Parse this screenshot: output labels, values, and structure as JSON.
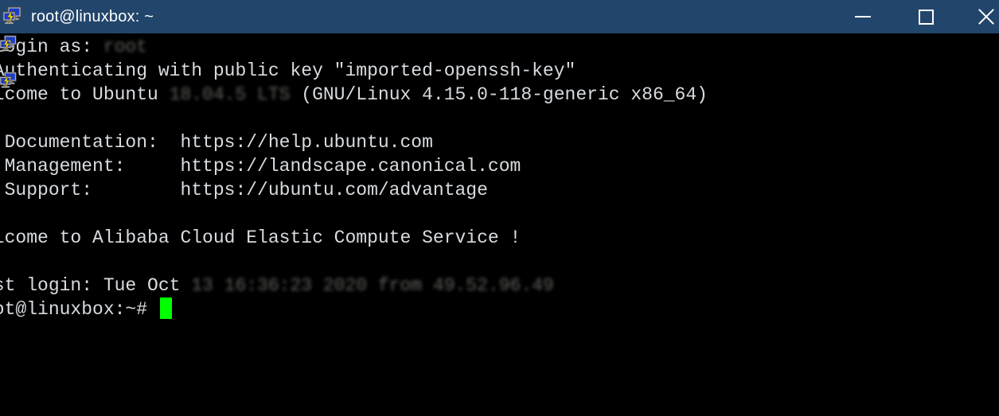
{
  "window": {
    "title": "root@linuxbox: ~",
    "app_icon": "putty-computer-icon",
    "titlebar_color": "#22456b",
    "background_color": "#000000",
    "controls": {
      "minimize_label": "—",
      "maximize_label": "☐",
      "close_label": "✕"
    }
  },
  "terminal": {
    "foreground_color": "#d8dce0",
    "cursor_color": "#00ff00",
    "lines": [
      {
        "id": "line-login-as",
        "segments": [
          {
            "text": " login as: ",
            "blurred": false
          },
          {
            "text": "root",
            "blurred": true
          }
        ]
      },
      {
        "id": "line-authenticating",
        "segments": [
          {
            "text": " Authenticating with public key \"imported-openssh-key\"",
            "blurred": false
          }
        ]
      },
      {
        "id": "line-welcome-ubuntu",
        "segments": [
          {
            "text": "elcome to Ubuntu ",
            "blurred": false
          },
          {
            "text": "18.04.5 LTS",
            "blurred": true
          },
          {
            "text": " (GNU/Linux 4.15.0-118-generic x86_64)",
            "blurred": false
          }
        ]
      },
      {
        "id": "line-blank-1",
        "segments": [
          {
            "text": " ",
            "blurred": false
          }
        ]
      },
      {
        "id": "line-documentation",
        "segments": [
          {
            "text": "* Documentation:  https://help.ubuntu.com",
            "blurred": false
          }
        ]
      },
      {
        "id": "line-management",
        "segments": [
          {
            "text": "* Management:     https://landscape.canonical.com",
            "blurred": false
          }
        ]
      },
      {
        "id": "line-support",
        "segments": [
          {
            "text": "* Support:        https://ubuntu.com/advantage",
            "blurred": false
          }
        ]
      },
      {
        "id": "line-blank-2",
        "segments": [
          {
            "text": " ",
            "blurred": false
          }
        ]
      },
      {
        "id": "line-welcome-alibaba",
        "segments": [
          {
            "text": "elcome to Alibaba Cloud Elastic Compute Service !",
            "blurred": false
          }
        ]
      },
      {
        "id": "line-blank-3",
        "segments": [
          {
            "text": " ",
            "blurred": false
          }
        ]
      },
      {
        "id": "line-last-login",
        "segments": [
          {
            "text": "ast login: Tue Oct ",
            "blurred": false
          },
          {
            "text": "13 16:36:23 2020 from 49.52.96.49",
            "blurred": true
          }
        ]
      }
    ],
    "prompt": {
      "text": "oot@linuxbox:~# ",
      "cursor": "block-cursor"
    }
  },
  "edge_icons": [
    {
      "id": "edge-icon-1",
      "name": "putty-computer-icon"
    },
    {
      "id": "edge-icon-2",
      "name": "putty-computer-icon"
    }
  ]
}
